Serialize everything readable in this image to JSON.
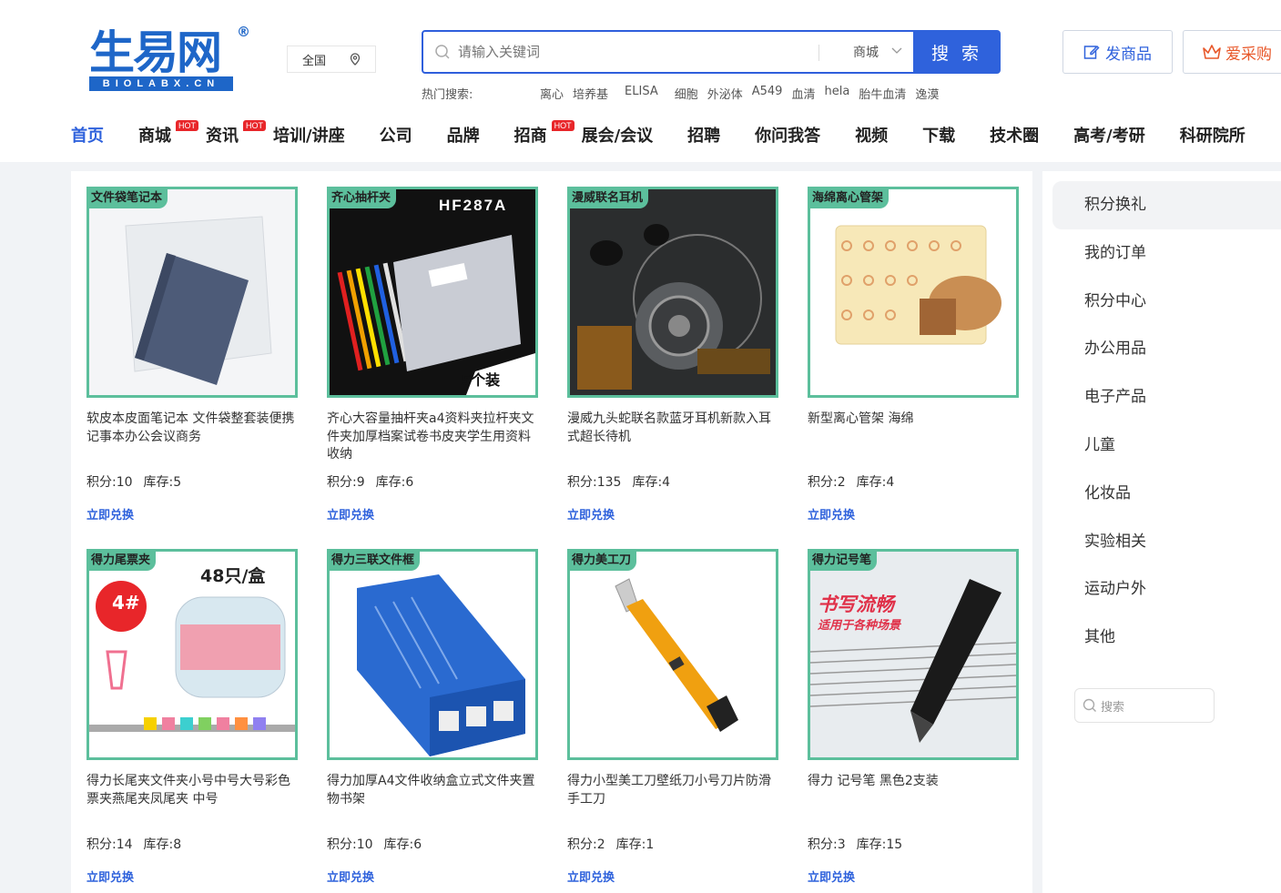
{
  "header": {
    "logo_text": "生易网",
    "logo_sub": "BIOLABX.CN",
    "logo_reg": "®",
    "region": "全国",
    "search": {
      "placeholder": "请输入关键词",
      "scope": "商城",
      "button": "搜 索"
    },
    "hot_label": "热门搜索:",
    "hot_keywords": [
      "离心",
      "培养基",
      "ELISA",
      "细胞",
      "外泌体",
      "A549",
      "血清",
      "hela",
      "胎牛血清",
      "逸漠"
    ],
    "post_button": "发商品",
    "buy_button": "爱采购"
  },
  "nav": [
    {
      "label": "首页",
      "active": true,
      "hot": false
    },
    {
      "label": "商城",
      "hot": true
    },
    {
      "label": "资讯",
      "hot": true
    },
    {
      "label": "培训/讲座",
      "hot": false
    },
    {
      "label": "公司",
      "hot": false
    },
    {
      "label": "品牌",
      "hot": false
    },
    {
      "label": "招商",
      "hot": true
    },
    {
      "label": "展会/会议",
      "hot": false
    },
    {
      "label": "招聘",
      "hot": false
    },
    {
      "label": "你问我答",
      "hot": false
    },
    {
      "label": "视频",
      "hot": false
    },
    {
      "label": "下载",
      "hot": false
    },
    {
      "label": "技术圈",
      "hot": false
    },
    {
      "label": "高考/考研",
      "hot": false
    },
    {
      "label": "科研院所",
      "hot": false
    }
  ],
  "hot_badge": "HOT",
  "products": [
    {
      "tag": "文件袋笔记本",
      "title": "软皮本皮面笔记本 文件袋整套装便携记事本办公会议商务",
      "points": "积分:10",
      "stock": "库存:5",
      "action": "立即兑换"
    },
    {
      "tag": "齐心抽杆夹",
      "title": "齐心大容量抽杆夹a4资料夹拉杆夹文件夹加厚档案试卷书皮夹学生用资料收纳",
      "points": "积分:9",
      "stock": "库存:6",
      "action": "立即兑换",
      "img_text": "HF287A",
      "img_sub": "5个装"
    },
    {
      "tag": "漫威联名耳机",
      "title": "漫威九头蛇联名款蓝牙耳机新款入耳式超长待机",
      "points": "积分:135",
      "stock": "库存:4",
      "action": "立即兑换"
    },
    {
      "tag": "海绵离心管架",
      "title": "新型离心管架 海绵",
      "points": "积分:2",
      "stock": "库存:4",
      "action": "立即兑换"
    },
    {
      "tag": "得力尾票夹",
      "title": "得力长尾夹文件夹小号中号大号彩色票夹燕尾夹凤尾夹 中号",
      "points": "积分:14",
      "stock": "库存:8",
      "action": "立即兑换",
      "img_text": "48只/盒",
      "img_sub": "4#"
    },
    {
      "tag": "得力三联文件框",
      "title": "得力加厚A4文件收纳盒立式文件夹置物书架",
      "points": "积分:10",
      "stock": "库存:6",
      "action": "立即兑换"
    },
    {
      "tag": "得力美工刀",
      "title": "得力小型美工刀壁纸刀小号刀片防滑手工刀",
      "points": "积分:2",
      "stock": "库存:1",
      "action": "立即兑换"
    },
    {
      "tag": "得力记号笔",
      "title": "得力 记号笔 黑色2支装",
      "points": "积分:3",
      "stock": "库存:15",
      "action": "立即兑换",
      "img_text": "书写流畅",
      "img_sub": "适用于各种场景"
    }
  ],
  "sidebar": {
    "items": [
      "积分换礼",
      "我的订单",
      "积分中心",
      "办公用品",
      "电子产品",
      "儿童",
      "化妆品",
      "实验相关",
      "运动户外",
      "其他"
    ],
    "search_placeholder": "搜索"
  },
  "colors": {
    "accent": "#2f62dc",
    "tag_green": "#5cbf9c",
    "hot_red": "#e8262a",
    "buy_orange": "#e8582a"
  }
}
